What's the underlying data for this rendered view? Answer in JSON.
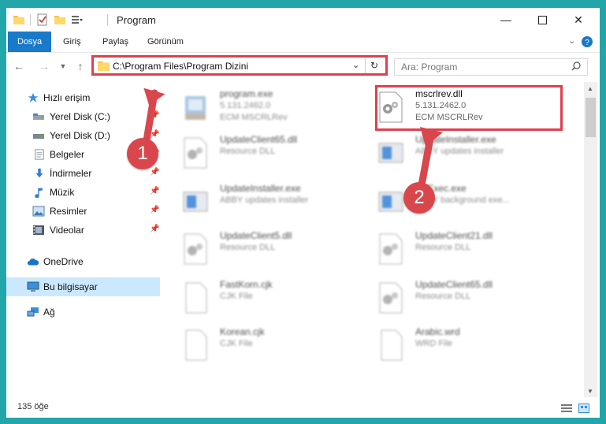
{
  "window": {
    "title": "Program"
  },
  "ribbon": {
    "tabs": [
      {
        "label": "Dosya",
        "active": true
      },
      {
        "label": "Giriş"
      },
      {
        "label": "Paylaş"
      },
      {
        "label": "Görünüm"
      }
    ],
    "expand_icon": "chevron-down-icon",
    "help_icon": "help-icon"
  },
  "address": {
    "path": "C:\\Program Files\\Program Dizini",
    "search_placeholder": "Ara: Program"
  },
  "sidebar": {
    "items": [
      {
        "label": "Hızlı erişim",
        "icon": "star-icon",
        "pinned": false
      },
      {
        "label": "Yerel Disk (C:)",
        "icon": "drive-icon",
        "pinned": true
      },
      {
        "label": "Yerel Disk (D:)",
        "icon": "drive-icon",
        "pinned": true
      },
      {
        "label": "Belgeler",
        "icon": "documents-icon",
        "pinned": true
      },
      {
        "label": "İndirmeler",
        "icon": "download-icon",
        "pinned": true
      },
      {
        "label": "Müzik",
        "icon": "music-icon",
        "pinned": true
      },
      {
        "label": "Resimler",
        "icon": "pictures-icon",
        "pinned": true
      },
      {
        "label": "Videolar",
        "icon": "video-icon",
        "pinned": true
      },
      {
        "label": "OneDrive",
        "icon": "cloud-icon",
        "pinned": false
      },
      {
        "label": "Bu bilgisayar",
        "icon": "computer-icon",
        "pinned": false,
        "selected": true
      },
      {
        "label": "Ağ",
        "icon": "network-icon",
        "pinned": false
      }
    ]
  },
  "files": [
    {
      "name": "program.exe",
      "line2": "5.131.2462.0",
      "line3": "ECM MSCRLRev",
      "icon": "exe-icon",
      "blurred": true
    },
    {
      "name": "mscrlrev.dll",
      "line2": "5.131.2462.0",
      "line3": "ECM MSCRLRev",
      "icon": "dll-gear-icon",
      "blurred": false,
      "highlighted": true
    },
    {
      "name": "UpdateClient65.dll",
      "line2": "Resource DLL",
      "icon": "dll-gear-icon",
      "blurred": true
    },
    {
      "name": "UpdateInstaller.exe",
      "line2": "ABBY updates installer",
      "icon": "installer-icon",
      "blurred": true
    },
    {
      "name": "UpdateInstaller.exe",
      "line2": "ABBY updates installer",
      "icon": "installer-icon",
      "blurred": true
    },
    {
      "name": "UpExec.exe",
      "line2": "ABBY background exe...",
      "icon": "installer-icon",
      "blurred": true
    },
    {
      "name": "UpdateClient5.dll",
      "line2": "Resource DLL",
      "icon": "dll-gear-icon",
      "blurred": true
    },
    {
      "name": "UpdateClient21.dll",
      "line2": "Resource DLL",
      "icon": "dll-gear-icon",
      "blurred": true
    },
    {
      "name": "FastKorn.cjk",
      "line2": "CJK File",
      "icon": "file-icon",
      "blurred": true
    },
    {
      "name": "UpdateClient65.dll",
      "line2": "Resource DLL",
      "icon": "dll-gear-icon",
      "blurred": true
    },
    {
      "name": "Korean.cjk",
      "line2": "CJK File",
      "icon": "file-icon",
      "blurred": true
    },
    {
      "name": "Arabic.wrd",
      "line2": "WRD File",
      "icon": "file-icon",
      "blurred": true
    }
  ],
  "status": {
    "count": "135 öğe"
  },
  "callouts": [
    {
      "label": "1"
    },
    {
      "label": "2"
    }
  ],
  "colors": {
    "accent": "#1979ca",
    "highlight": "#e0404e",
    "selected": "#cce8ff",
    "frame": "#23a6a9"
  }
}
